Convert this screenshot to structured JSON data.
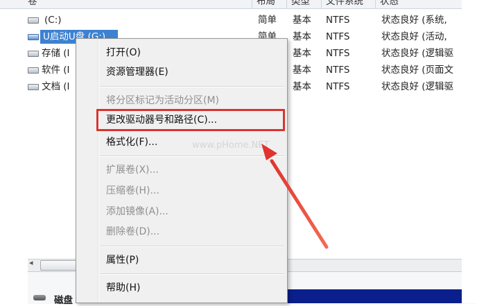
{
  "columns": {
    "volume": "卷",
    "layout": "布局",
    "type": "类型",
    "filesystem": "文件系统",
    "status": "状态"
  },
  "volumes": [
    {
      "name": "(C:)",
      "layout": "简单",
      "type": "基本",
      "fs": "NTFS",
      "status": "状态良好 (系统,"
    },
    {
      "name": "U启动U盘 (G:)",
      "layout": "简单",
      "type": "基本",
      "fs": "NTFS",
      "status": "状态良好 (活动,"
    },
    {
      "name": "存储 (I",
      "layout": "",
      "type": "基本",
      "fs": "NTFS",
      "status": "状态良好 (逻辑驱"
    },
    {
      "name": "软件 (I",
      "layout": "",
      "type": "基本",
      "fs": "NTFS",
      "status": "状态良好 (页面文"
    },
    {
      "name": "文档 (I",
      "layout": "",
      "type": "基本",
      "fs": "NTFS",
      "status": "状态良好 (逻辑驱"
    }
  ],
  "context_menu": {
    "open": "打开(O)",
    "explorer": "资源管理器(E)",
    "mark_active": "将分区标记为活动分区(M)",
    "change_letter": "更改驱动器号和路径(C)...",
    "format": "格式化(F)...",
    "extend": "扩展卷(X)...",
    "shrink": "压缩卷(H)...",
    "add_mirror": "添加镜像(A)...",
    "delete": "删除卷(D)...",
    "properties": "属性(P)",
    "help": "帮助(H)"
  },
  "watermark": "www.pHome.NET",
  "lower_pane": {
    "disk_label": "磁盘"
  },
  "colors": {
    "selection": "#3d82d1",
    "highlight_box": "#d8342f",
    "arrow": "#e0342e",
    "disk_bar": "#0a1f8c"
  }
}
